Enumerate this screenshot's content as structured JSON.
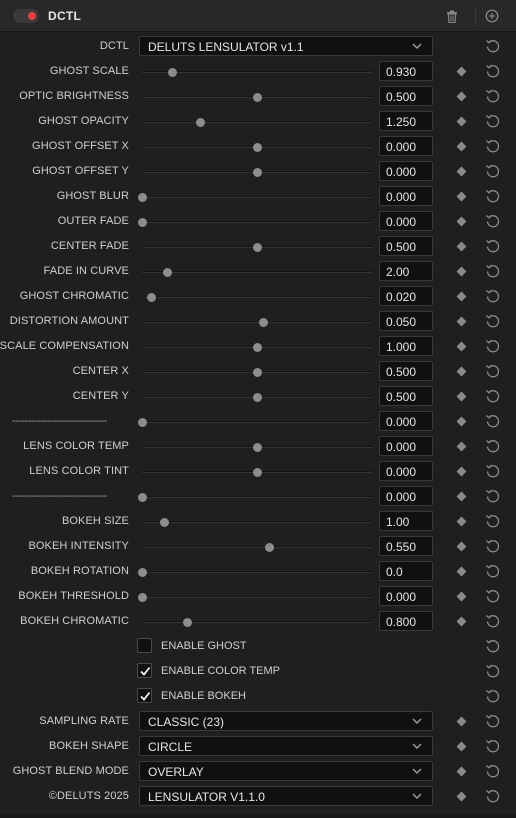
{
  "header": {
    "title": "DCTL",
    "enabled": true
  },
  "dctl_row": {
    "label": "DCTL",
    "value": "DELUTS LENSULATOR v1.1"
  },
  "sliders": [
    {
      "label": "GHOST SCALE",
      "value": "0.930",
      "pos": 0.13
    },
    {
      "label": "OPTIC BRIGHTNESS",
      "value": "0.500",
      "pos": 0.5
    },
    {
      "label": "GHOST OPACITY",
      "value": "1.250",
      "pos": 0.25
    },
    {
      "label": "GHOST OFFSET X",
      "value": "0.000",
      "pos": 0.5
    },
    {
      "label": "GHOST OFFSET Y",
      "value": "0.000",
      "pos": 0.5
    },
    {
      "label": "GHOST BLUR",
      "value": "0.000",
      "pos": 0.0
    },
    {
      "label": "OUTER FADE",
      "value": "0.000",
      "pos": 0.0
    },
    {
      "label": "CENTER FADE",
      "value": "0.500",
      "pos": 0.5
    },
    {
      "label": "FADE IN CURVE",
      "value": "2.00",
      "pos": 0.11
    },
    {
      "label": "GHOST CHROMATIC",
      "value": "0.020",
      "pos": 0.04
    },
    {
      "label": "DISTORTION AMOUNT",
      "value": "0.050",
      "pos": 0.525
    },
    {
      "label": "SCALE COMPENSATION",
      "value": "1.000",
      "pos": 0.5
    },
    {
      "label": "CENTER X",
      "value": "0.500",
      "pos": 0.5
    },
    {
      "label": "CENTER Y",
      "value": "0.500",
      "pos": 0.5
    },
    {
      "label": "------------------------------",
      "value": "0.000",
      "pos": 0.0,
      "separator": true
    },
    {
      "label": "LENS COLOR TEMP",
      "value": "0.000",
      "pos": 0.5
    },
    {
      "label": "LENS COLOR TINT",
      "value": "0.000",
      "pos": 0.5
    },
    {
      "label": "------------------------------",
      "value": "0.000",
      "pos": 0.0,
      "separator": true
    },
    {
      "label": "BOKEH SIZE",
      "value": "1.00",
      "pos": 0.095
    },
    {
      "label": "BOKEH INTENSITY",
      "value": "0.550",
      "pos": 0.55
    },
    {
      "label": "BOKEH ROTATION",
      "value": "0.0",
      "pos": 0.0
    },
    {
      "label": "BOKEH THRESHOLD",
      "value": "0.000",
      "pos": 0.0
    },
    {
      "label": "BOKEH CHROMATIC",
      "value": "0.800",
      "pos": 0.195
    }
  ],
  "checkboxes": [
    {
      "label": "ENABLE GHOST",
      "checked": false
    },
    {
      "label": "ENABLE COLOR TEMP",
      "checked": true
    },
    {
      "label": "ENABLE BOKEH",
      "checked": true
    }
  ],
  "dropdowns": [
    {
      "label": "SAMPLING RATE",
      "value": "CLASSIC (23)"
    },
    {
      "label": "BOKEH SHAPE",
      "value": "CIRCLE"
    },
    {
      "label": "GHOST BLEND MODE",
      "value": "OVERLAY"
    },
    {
      "label": "©DELUTS 2025",
      "value": "LENSULATOR V1.1.0"
    }
  ],
  "icons": {
    "toggle": "power-toggle-icon",
    "trash": "trash-icon",
    "add": "add-node-icon",
    "reset": "reset-icon",
    "keyframe": "keyframe-diamond-icon",
    "chevron": "chevron-down-icon",
    "check": "checkmark-icon"
  },
  "colors": {
    "toggle_on": "#e8423b",
    "background": "#1f1f21",
    "field": "#101011"
  }
}
